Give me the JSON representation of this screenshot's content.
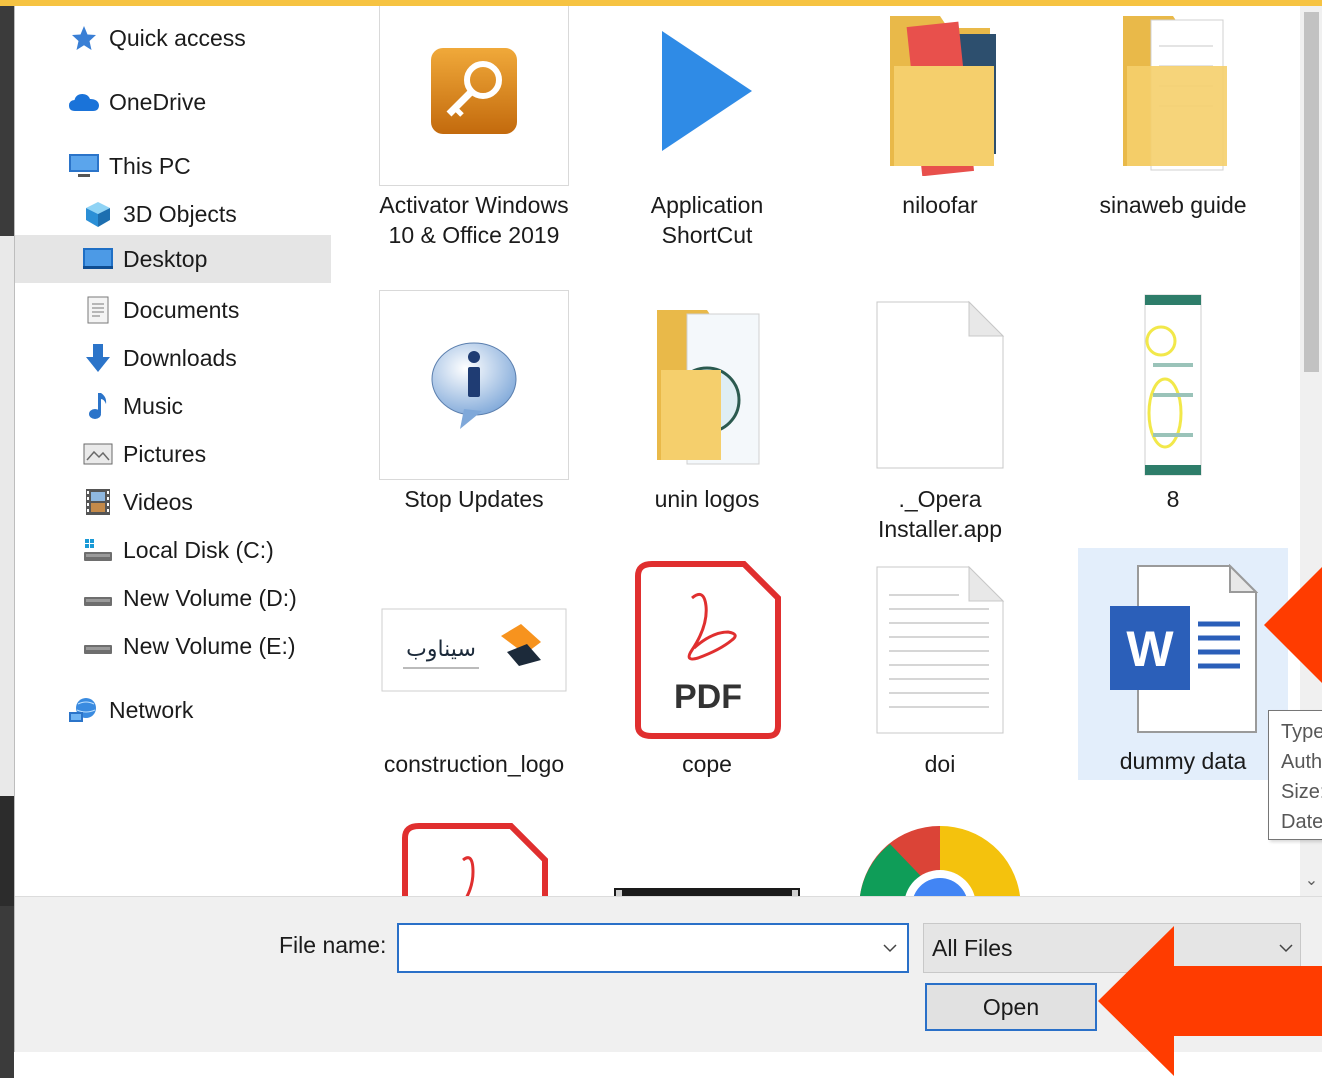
{
  "nav": {
    "items": [
      {
        "label": "Quick access",
        "icon": "star-icon"
      },
      {
        "label": "OneDrive",
        "icon": "cloud-icon"
      },
      {
        "label": "This PC",
        "icon": "computer-icon"
      },
      {
        "label": "3D Objects",
        "icon": "cube-icon"
      },
      {
        "label": "Desktop",
        "icon": "desktop-icon",
        "selected": true
      },
      {
        "label": "Documents",
        "icon": "documents-icon"
      },
      {
        "label": "Downloads",
        "icon": "download-arrow-icon"
      },
      {
        "label": "Music",
        "icon": "music-note-icon"
      },
      {
        "label": "Pictures",
        "icon": "pictures-icon"
      },
      {
        "label": "Videos",
        "icon": "film-icon"
      },
      {
        "label": "Local Disk (C:)",
        "icon": "local-disk-icon"
      },
      {
        "label": "New Volume (D:)",
        "icon": "drive-icon"
      },
      {
        "label": "New Volume (E:)",
        "icon": "drive-icon"
      },
      {
        "label": "Network",
        "icon": "network-icon"
      }
    ]
  },
  "files": [
    {
      "name": "Activator Windows 10 & Office 2019",
      "icon": "key-app-icon"
    },
    {
      "name": "Application ShortCut",
      "icon": "play-triangle-icon"
    },
    {
      "name": "niloofar",
      "icon": "folder-icon"
    },
    {
      "name": "sinaweb guide",
      "icon": "folder-icon"
    },
    {
      "name": "Stop Updates",
      "icon": "info-bubble-icon"
    },
    {
      "name": "unin logos",
      "icon": "folder-icon"
    },
    {
      "name": "._Opera Installer.app",
      "icon": "blank-file-icon"
    },
    {
      "name": "8",
      "icon": "image-thumbnail-icon"
    },
    {
      "name": "construction_logo",
      "icon": "logo-thumbnail-icon",
      "logo_text": "سیناوب"
    },
    {
      "name": "cope",
      "icon": "pdf-icon",
      "badge": "PDF"
    },
    {
      "name": "doi",
      "icon": "text-file-icon"
    },
    {
      "name": "dummy data",
      "icon": "word-doc-icon",
      "badge": "W",
      "selected": true
    },
    {
      "name": "",
      "icon": "pdf-icon"
    },
    {
      "name": "",
      "icon": "image-thumbnail-icon"
    },
    {
      "name": "",
      "icon": "chrome-icon"
    }
  ],
  "tooltip": {
    "lines": [
      "Type",
      "Auth",
      "Size:",
      "Date"
    ]
  },
  "bottom": {
    "file_name_label": "File name:",
    "file_name_value": "",
    "filter_label": "All Files",
    "open_label": "Open"
  },
  "colors": {
    "accent": "#2a70c8",
    "selection": "#e3eefb",
    "annotation_arrow": "#ff3c00",
    "top_bar": "#f6c342"
  }
}
